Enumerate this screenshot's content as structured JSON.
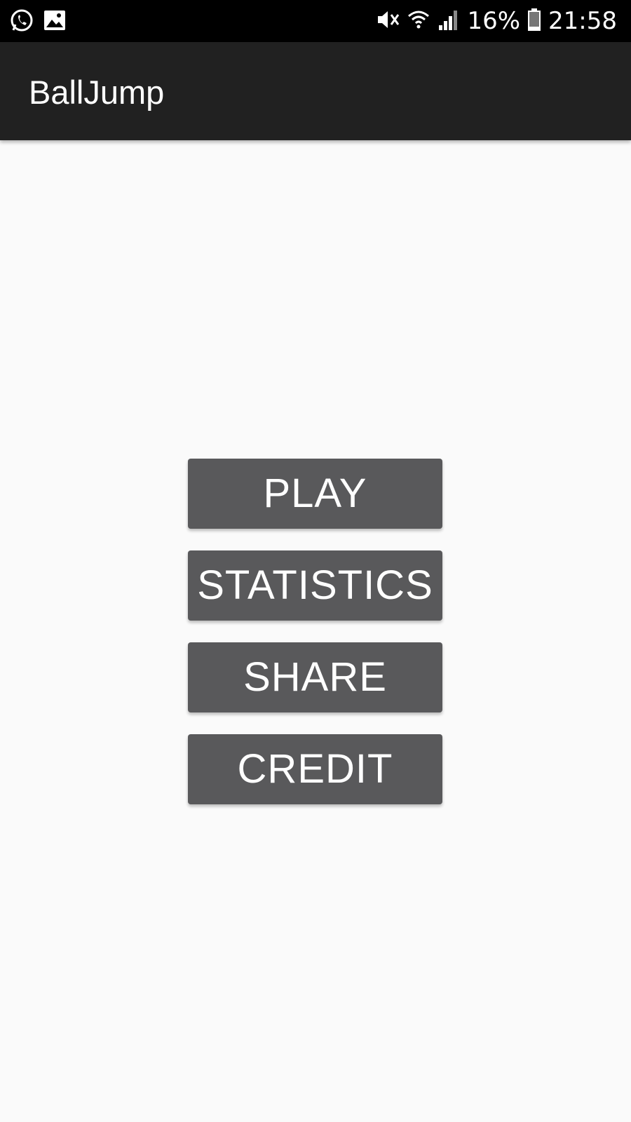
{
  "status_bar": {
    "battery_percent": "16%",
    "time": "21:58",
    "icons": [
      "whatsapp-icon",
      "gallery-icon",
      "mute-icon",
      "wifi-icon",
      "signal-icon",
      "battery-icon"
    ]
  },
  "app_bar": {
    "title": "BallJump"
  },
  "menu": {
    "play_label": "PLAY",
    "statistics_label": "STATISTICS",
    "share_label": "SHARE",
    "credit_label": "CREDIT"
  },
  "colors": {
    "status_bar_bg": "#000000",
    "app_bar_bg": "#212121",
    "page_bg": "#fafafa",
    "button_bg": "#59595b",
    "button_text": "#ffffff"
  }
}
